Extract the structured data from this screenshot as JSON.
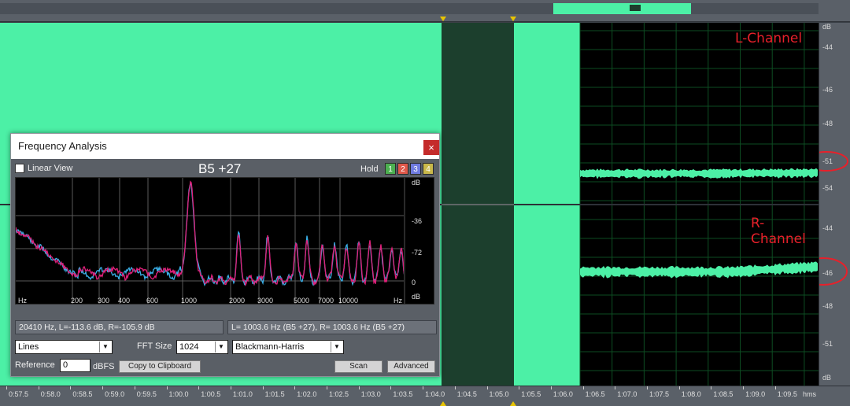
{
  "channels": {
    "left_label": "L-Channel",
    "right_label": "R-Channel"
  },
  "db_ruler": {
    "unit_top": "dB",
    "ticks_top": [
      "-44",
      "-46",
      "-48",
      "-51",
      "-54"
    ],
    "ticks_bottom": [
      "-44",
      "-46",
      "-48",
      "-51"
    ],
    "unit_bottom": "dB"
  },
  "timeline": {
    "labels": [
      "0:57.5",
      "0:58.0",
      "0:58.5",
      "0:59.0",
      "0:59.5",
      "1:00.0",
      "1:00.5",
      "1:01.0",
      "1:01.5",
      "1:02.0",
      "1:02.5",
      "1:03.0",
      "1:03.5",
      "1:04.0",
      "1:04.5",
      "1:05.0",
      "1:05.5",
      "1:06.0",
      "1:06.5",
      "1:07.0",
      "1:07.5",
      "1:08.0",
      "1:08.5",
      "1:09.0",
      "1:09.5"
    ],
    "unit": "hms"
  },
  "dialog": {
    "title": "Frequency Analysis",
    "close": "×",
    "linear_view": "Linear View",
    "note": "B5 +27",
    "hold_label": "Hold",
    "hold_buttons": [
      "1",
      "2",
      "3",
      "4"
    ],
    "hold_colors": [
      "#4caf50",
      "#e0584a",
      "#6f7be0",
      "#c9b84a"
    ],
    "db_axis": [
      "dB",
      "-36",
      "-72",
      "0",
      "dB"
    ],
    "freq_axis": [
      "Hz",
      "200",
      "300",
      "400",
      "600",
      "1000",
      "2000",
      "3000",
      "5000",
      "7000",
      "10000",
      "Hz"
    ],
    "cursor_info": "20410 Hz, L=-113.6 dB, R=-105.9 dB",
    "peak_info": "L= 1003.6 Hz (B5 +27), R= 1003.6 Hz (B5 +27)",
    "graph_type": "Lines",
    "fft_label": "FFT Size",
    "fft_size": "1024",
    "window": "Blackmann-Harris",
    "reference_label": "Reference",
    "reference_value": "0",
    "dbfs_label": "dBFS",
    "copy_button": "Copy to Clipboard",
    "scan_button": "Scan",
    "advanced_button": "Advanced"
  },
  "colors": {
    "waveform": "#4cf0a6",
    "selection": "#1c3f2d",
    "annotation": "#e8202a",
    "left_spectrum": "#e0207a",
    "right_spectrum": "#3ab0e8"
  }
}
